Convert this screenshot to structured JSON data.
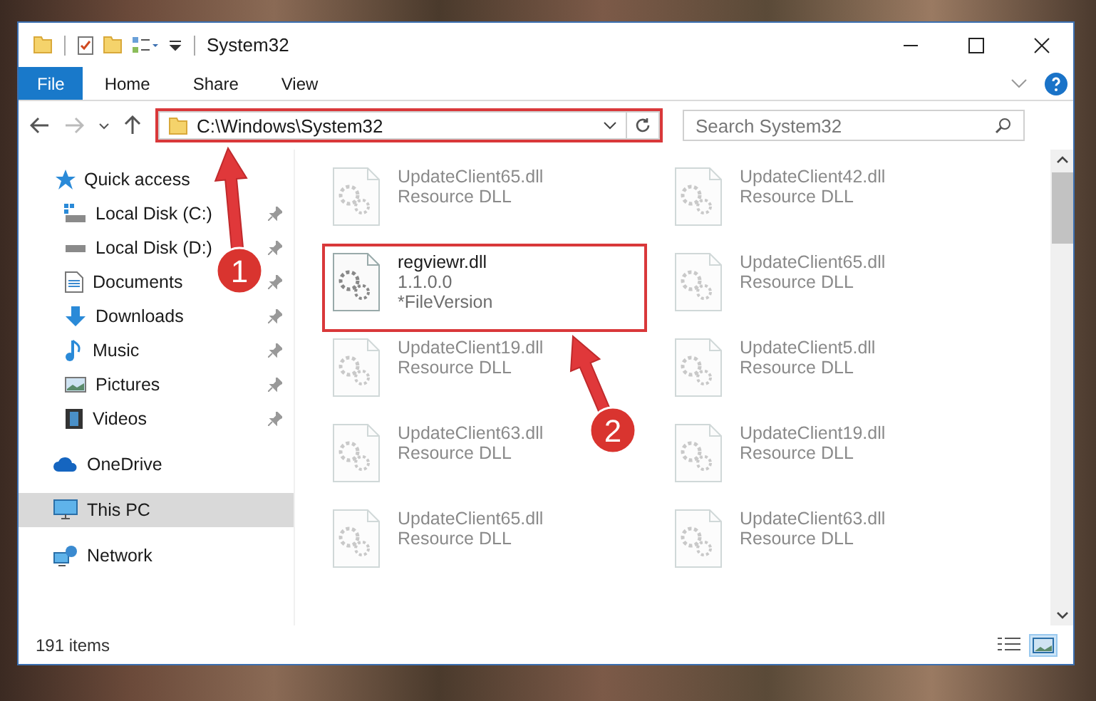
{
  "window": {
    "title": "System32"
  },
  "ribbon_tabs": [
    {
      "label": "File",
      "kind": "file",
      "selected": false
    },
    {
      "label": "Home",
      "kind": "tab",
      "selected": false
    },
    {
      "label": "Share",
      "kind": "tab",
      "selected": false
    },
    {
      "label": "View",
      "kind": "tab",
      "selected": false
    }
  ],
  "address_bar": {
    "path": "C:\\Windows\\System32",
    "annotated": true
  },
  "search": {
    "placeholder": "Search System32"
  },
  "sidebar": {
    "items": [
      {
        "label": "Quick access",
        "kind": "quick",
        "selected": false,
        "children": [
          {
            "label": "Local Disk (C:)",
            "kind": "disk-c",
            "pinned": true
          },
          {
            "label": "Local Disk (D:)",
            "kind": "disk",
            "pinned": true
          },
          {
            "label": "Documents",
            "kind": "documents",
            "pinned": true
          },
          {
            "label": "Downloads",
            "kind": "downloads",
            "pinned": true
          },
          {
            "label": "Music",
            "kind": "music",
            "pinned": true
          },
          {
            "label": "Pictures",
            "kind": "pictures",
            "pinned": true
          },
          {
            "label": "Videos",
            "kind": "videos",
            "pinned": true
          }
        ]
      },
      {
        "label": "OneDrive",
        "kind": "cloud",
        "selected": false
      },
      {
        "label": "This PC",
        "kind": "pc",
        "selected": true
      },
      {
        "label": "Network",
        "kind": "network",
        "selected": false
      }
    ]
  },
  "files": [
    {
      "name": "UpdateClient65.dll",
      "detail": [
        "Resource DLL"
      ],
      "faded": true,
      "annotated": false
    },
    {
      "name": "UpdateClient42.dll",
      "detail": [
        "Resource DLL"
      ],
      "faded": true,
      "annotated": false
    },
    {
      "name": "regviewr.dll",
      "detail": [
        "1.1.0.0",
        "*FileVersion"
      ],
      "faded": false,
      "annotated": true
    },
    {
      "name": "UpdateClient65.dll",
      "detail": [
        "Resource DLL"
      ],
      "faded": true,
      "annotated": false
    },
    {
      "name": "UpdateClient19.dll",
      "detail": [
        "Resource DLL"
      ],
      "faded": true,
      "annotated": false
    },
    {
      "name": "UpdateClient5.dll",
      "detail": [
        "Resource DLL"
      ],
      "faded": true,
      "annotated": false
    },
    {
      "name": "UpdateClient63.dll",
      "detail": [
        "Resource DLL"
      ],
      "faded": true,
      "annotated": false
    },
    {
      "name": "UpdateClient19.dll",
      "detail": [
        "Resource DLL"
      ],
      "faded": true,
      "annotated": false
    },
    {
      "name": "UpdateClient65.dll",
      "detail": [
        "Resource DLL"
      ],
      "faded": true,
      "annotated": false
    },
    {
      "name": "UpdateClient63.dll",
      "detail": [
        "Resource DLL"
      ],
      "faded": true,
      "annotated": false
    }
  ],
  "status_bar": {
    "count": "191 items",
    "views": [
      {
        "kind": "details",
        "selected": false
      },
      {
        "kind": "large-icons",
        "selected": true
      }
    ]
  },
  "annotations": [
    {
      "label": "1"
    },
    {
      "label": "2"
    }
  ]
}
